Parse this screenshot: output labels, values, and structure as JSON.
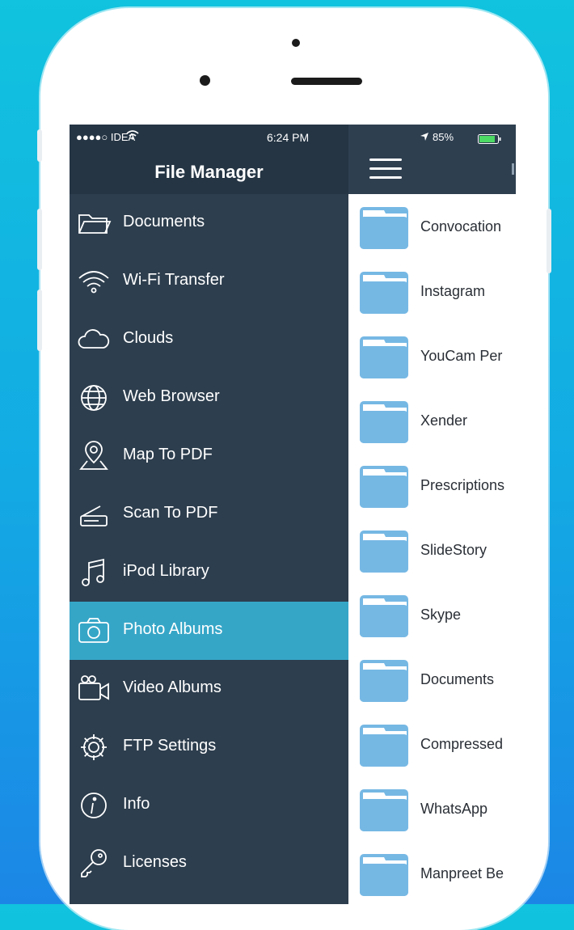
{
  "status_bar": {
    "carrier": "●●●●○ IDEA",
    "time": "6:24 PM",
    "battery": "85%"
  },
  "drawer": {
    "title": "File Manager",
    "items": [
      {
        "label": "Documents",
        "icon": "folder-icon"
      },
      {
        "label": "Wi-Fi Transfer",
        "icon": "wifi-icon"
      },
      {
        "label": "Clouds",
        "icon": "cloud-icon"
      },
      {
        "label": "Web Browser",
        "icon": "globe-icon"
      },
      {
        "label": "Map To PDF",
        "icon": "map-pin-icon"
      },
      {
        "label": "Scan To PDF",
        "icon": "scanner-icon"
      },
      {
        "label": "iPod Library",
        "icon": "music-note-icon"
      },
      {
        "label": "Photo Albums",
        "icon": "camera-icon",
        "selected": true
      },
      {
        "label": "Video Albums",
        "icon": "video-camera-icon"
      },
      {
        "label": "FTP Settings",
        "icon": "gear-icon"
      },
      {
        "label": "Info",
        "icon": "info-icon"
      },
      {
        "label": "Licenses",
        "icon": "key-icon"
      }
    ]
  },
  "files": [
    {
      "name": "Convocation"
    },
    {
      "name": "Instagram"
    },
    {
      "name": "YouCam Per"
    },
    {
      "name": "Xender"
    },
    {
      "name": "Prescriptions"
    },
    {
      "name": "SlideStory"
    },
    {
      "name": "Skype"
    },
    {
      "name": "Documents"
    },
    {
      "name": "Compressed"
    },
    {
      "name": "WhatsApp"
    },
    {
      "name": "Manpreet Be"
    }
  ],
  "colors": {
    "drawer_bg": "#2d3e4e",
    "selected_bg": "#36a6c7",
    "folder_blue": "#72b6e2",
    "background_gradient": [
      "#11c3de",
      "#1c86e6"
    ]
  }
}
